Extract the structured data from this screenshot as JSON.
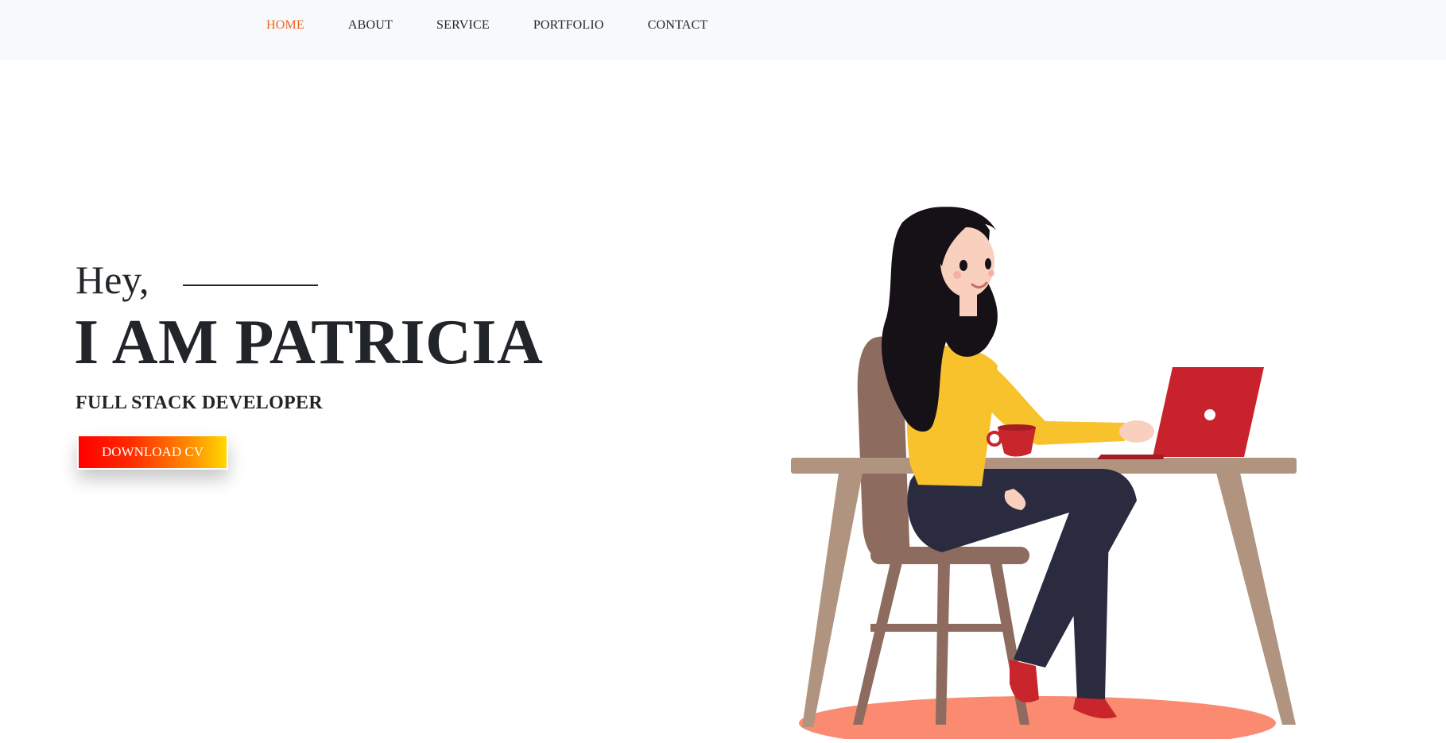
{
  "nav": {
    "items": [
      {
        "label": "HOME",
        "active": true
      },
      {
        "label": "ABOUT",
        "active": false
      },
      {
        "label": "SERVICE",
        "active": false
      },
      {
        "label": "PORTFOLIO",
        "active": false
      },
      {
        "label": "CONTACT",
        "active": false
      }
    ],
    "active_color": "#f26522"
  },
  "hero": {
    "greeting": "Hey,",
    "name": "I AM PATRICIA",
    "role": "FULL STACK DEVELOPER",
    "cta_label": "DOWNLOAD CV"
  },
  "illustration": {
    "icon": "woman-working-at-laptop-illustration"
  }
}
